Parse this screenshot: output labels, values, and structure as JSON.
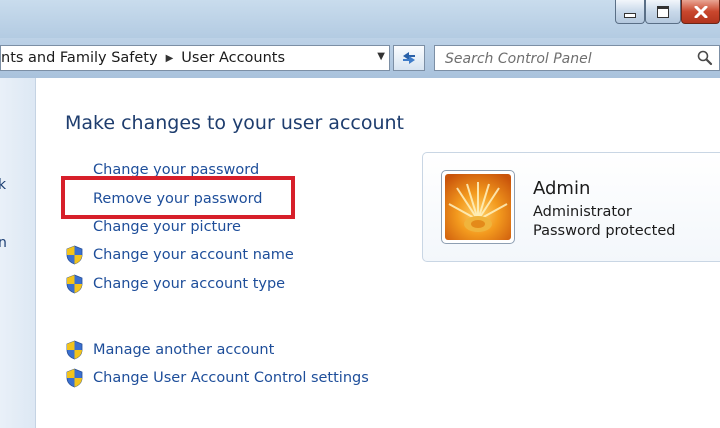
{
  "window": {
    "buttons": {
      "minimize": "minimize-icon",
      "maximize": "maximize-icon",
      "close": "close-icon"
    }
  },
  "address_bar": {
    "crumbs": [
      "nts and Family Safety",
      "User Accounts"
    ],
    "separator_icon": "chevron-right-icon",
    "dropdown_icon": "chevron-down-icon",
    "refresh_icon": "refresh-arrows-icon"
  },
  "search": {
    "placeholder": "Search Control Panel",
    "icon": "magnifier-icon"
  },
  "nav_pane": {
    "fragments": [
      "k",
      "n"
    ]
  },
  "main": {
    "heading": "Make changes to your user account",
    "tasks": [
      {
        "label": "Change your password",
        "shield": false
      },
      {
        "label": "Remove your password",
        "shield": false,
        "highlighted": true
      },
      {
        "label": "Change your picture",
        "shield": false
      },
      {
        "label": "Change your account name",
        "shield": true
      },
      {
        "label": "Change your account type",
        "shield": true
      },
      {
        "label": "Manage another account",
        "shield": true
      },
      {
        "label": "Change User Account Control settings",
        "shield": true
      }
    ],
    "highlight_color": "#d71f2a",
    "link_color": "#1e4e9a"
  },
  "account": {
    "name": "Admin",
    "role": "Administrator",
    "status": "Password protected",
    "picture_icon": "orange-flower-picture"
  }
}
